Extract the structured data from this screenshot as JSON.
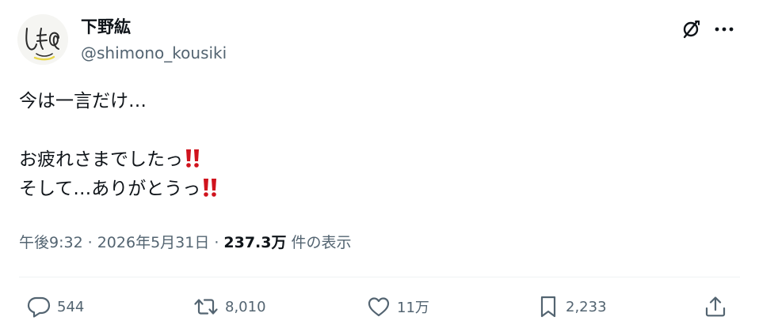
{
  "author": {
    "display_name": "下野紘",
    "handle": "@shimono_kousiki",
    "avatar_text": "しもの"
  },
  "header_actions": {
    "grok_icon": "grok-slash-icon",
    "more_icon": "more-horizontal-icon"
  },
  "tweet": {
    "lines": [
      "今は一言だけ…",
      "",
      "お疲れさまでしたっ",
      "そして…ありがとうっ"
    ],
    "emoji": "‼️",
    "emoji_color": "#d0131d"
  },
  "meta": {
    "time": "午後9:32",
    "separator": "·",
    "date": "2026年5月31日",
    "views_count": "237.3万",
    "views_label": "件の表示"
  },
  "actions": {
    "reply_count": "544",
    "retweet_count": "8,010",
    "like_count": "11万",
    "bookmark_count": "2,233"
  },
  "colors": {
    "text_primary": "#0f1419",
    "text_secondary": "#536471",
    "divider": "#eff3f4"
  }
}
